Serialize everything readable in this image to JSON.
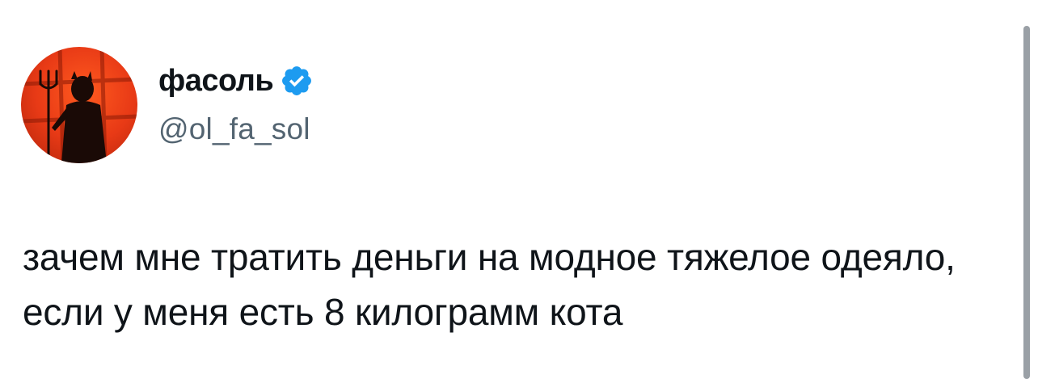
{
  "tweet": {
    "display_name": "фасоль",
    "handle": "@ol_fa_sol",
    "verified": true,
    "text": "зачем мне тратить деньги на модное тяжелое одеяло, если у меня есть 8 килограмм кота"
  },
  "icons": {
    "verified": "verified-badge-icon",
    "avatar": "avatar-image"
  },
  "colors": {
    "text_primary": "#0f1419",
    "text_secondary": "#536471",
    "verified_blue": "#1d9bf0",
    "avatar_red": "#e83a16",
    "scrollbar": "#9aa0a6"
  }
}
